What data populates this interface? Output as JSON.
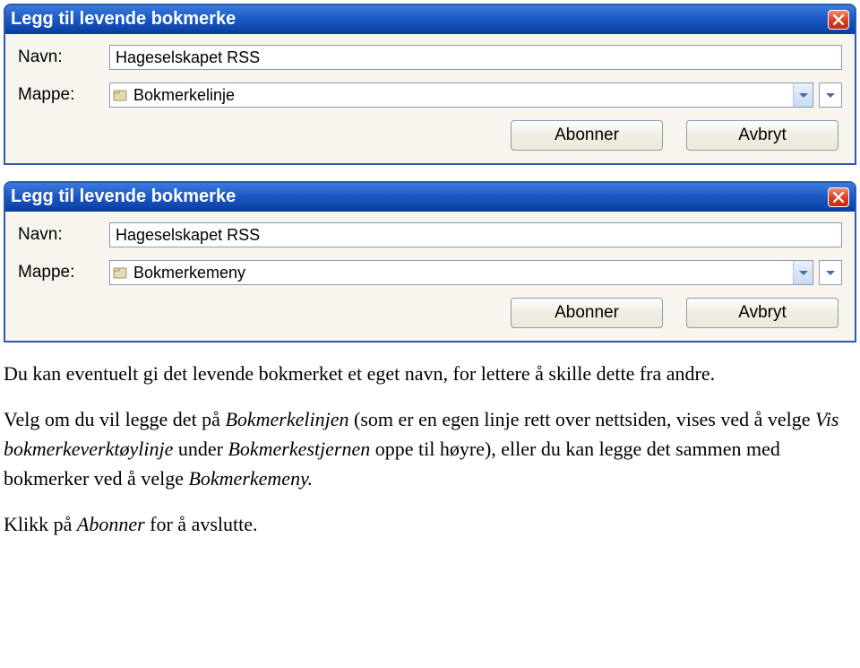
{
  "dialog1": {
    "title": "Legg til levende bokmerke",
    "name_label": "Navn:",
    "name_value": "Hageselskapet RSS",
    "folder_label": "Mappe:",
    "folder_value": "Bokmerkelinje",
    "subscribe": "Abonner",
    "cancel": "Avbryt"
  },
  "dialog2": {
    "title": "Legg til levende bokmerke",
    "name_label": "Navn:",
    "name_value": "Hageselskapet RSS",
    "folder_label": "Mappe:",
    "folder_value": "Bokmerkemeny",
    "subscribe": "Abonner",
    "cancel": "Avbryt"
  },
  "text": {
    "p1": "Du kan eventuelt gi det levende bokmerket et eget navn, for lettere å skille dette fra andre.",
    "p2_pre": "Velg om du vil legge det på ",
    "p2_i1": "Bokmerkelinjen",
    "p2_mid1": " (som er en egen linje rett over nettsiden, vises ved å velge ",
    "p2_i2": "Vis bokmerkeverktøylinje",
    "p2_mid2": " under ",
    "p2_i3": "Bokmerkestjernen",
    "p2_mid3": " oppe til høyre), eller du kan legge det sammen med bokmerker ved å velge ",
    "p2_i4": "Bokmerkemeny.",
    "p3_pre": "Klikk på ",
    "p3_i1": "Abonner",
    "p3_post": " for å avslutte."
  }
}
